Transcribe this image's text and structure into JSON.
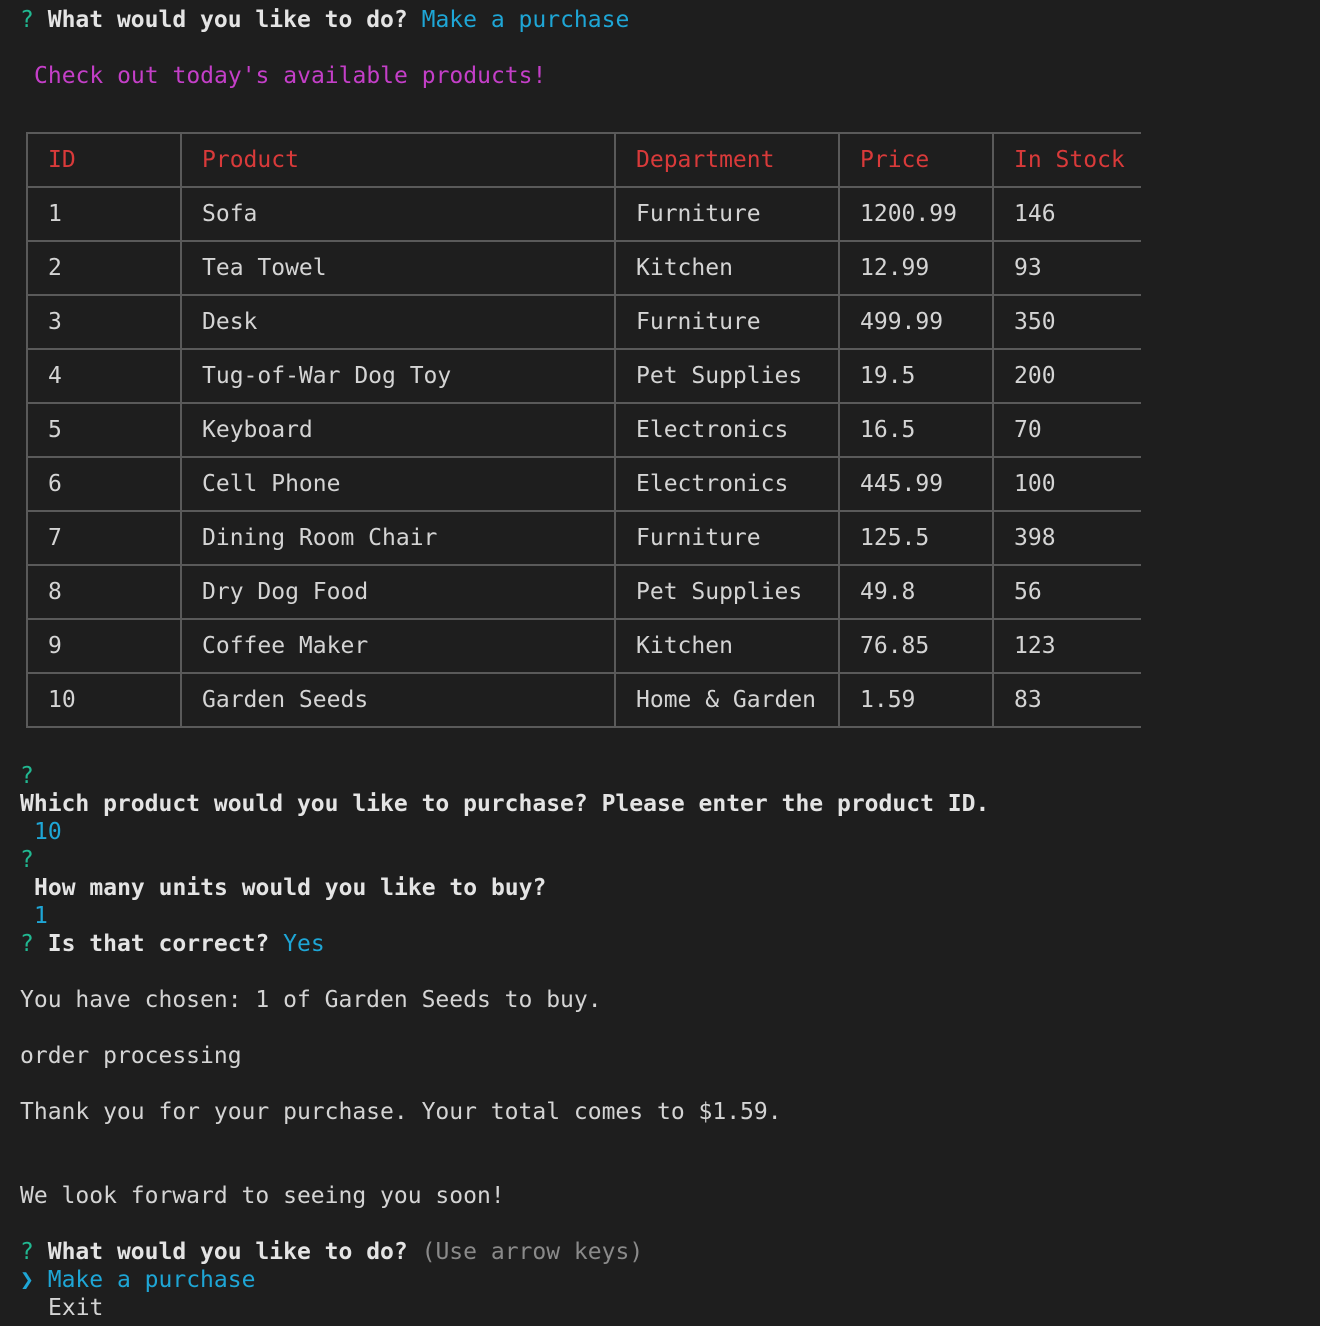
{
  "session": {
    "prompt_marker": "?",
    "first_question": "What would you like to do?",
    "first_answer": "Make a purchase",
    "banner": "Check out today's available products!",
    "table": {
      "headers": [
        "ID",
        "Product",
        "Department",
        "Price",
        "In Stock"
      ],
      "rows": [
        [
          "1",
          "Sofa",
          "Furniture",
          "1200.99",
          "146"
        ],
        [
          "2",
          "Tea Towel",
          "Kitchen",
          "12.99",
          "93"
        ],
        [
          "3",
          "Desk",
          "Furniture",
          "499.99",
          "350"
        ],
        [
          "4",
          "Tug-of-War Dog Toy",
          "Pet Supplies",
          "19.5",
          "200"
        ],
        [
          "5",
          "Keyboard",
          "Electronics",
          "16.5",
          "70"
        ],
        [
          "6",
          "Cell Phone",
          "Electronics",
          "445.99",
          "100"
        ],
        [
          "7",
          "Dining Room Chair",
          "Furniture",
          "125.5",
          "398"
        ],
        [
          "8",
          "Dry Dog Food",
          "Pet Supplies",
          "49.8",
          "56"
        ],
        [
          "9",
          "Coffee Maker",
          "Kitchen",
          "76.85",
          "123"
        ],
        [
          "10",
          "Garden Seeds",
          "Home & Garden",
          "1.59",
          "83"
        ]
      ]
    },
    "product_question": "Which product would you like to purchase? Please enter the product ID.",
    "product_answer": "10",
    "units_question": "How many units would you like to buy?",
    "units_answer": "1",
    "confirm_question": "Is that correct?",
    "confirm_answer": "Yes",
    "chosen_msg": "You have chosen: 1 of Garden Seeds to buy.",
    "processing_msg": "order processing",
    "thanks_msg": "Thank you for your purchase. Your total comes to $1.59.",
    "farewell_msg": "We look forward to seeing you soon!",
    "menu_question": "What would you like to do?",
    "menu_hint": "(Use arrow keys)",
    "menu_pointer": "❯",
    "menu_options": [
      "Make a purchase",
      "Exit"
    ]
  },
  "colors": {
    "background": "#1e1e1e",
    "prompt": "#21b891",
    "answer": "#1ea6d6",
    "banner": "#c43fc8",
    "table_header": "#d93a3a",
    "table_border": "#5a5a5a"
  }
}
